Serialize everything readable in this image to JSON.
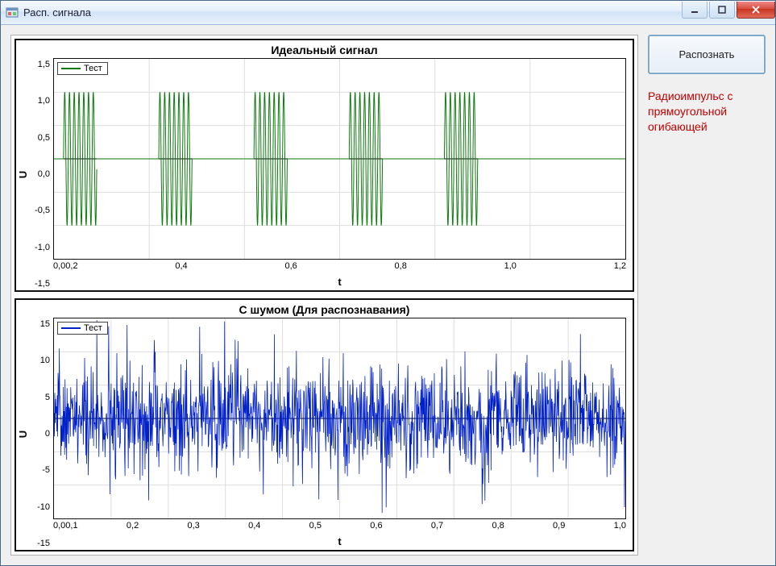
{
  "window": {
    "title": "Расп. сигнала"
  },
  "side": {
    "recognize_label": "Распознать",
    "result_text": "Радиоимпульс с прямоугольной огибающей"
  },
  "chart_data": [
    {
      "type": "line",
      "title": "Идеальный сигнал",
      "xlabel": "t",
      "ylabel": "U",
      "xlim": [
        0.0,
        1.2
      ],
      "ylim": [
        -1.5,
        1.5
      ],
      "x_ticks": [
        "0,0",
        "0,2",
        "0,4",
        "0,6",
        "0,8",
        "1,0",
        "1,2"
      ],
      "y_ticks": [
        "1,5",
        "1,0",
        "0,5",
        "0,0",
        "-0,5",
        "-1,0",
        "-1,5"
      ],
      "legend": "Тест",
      "color": "#0a7a0a",
      "description": "5 rectangular-envelope sine bursts, amplitude ±1",
      "bursts": [
        {
          "t_start": 0.02,
          "t_end": 0.09,
          "freq_hz": 100,
          "amplitude": 1.0
        },
        {
          "t_start": 0.22,
          "t_end": 0.29,
          "freq_hz": 100,
          "amplitude": 1.0
        },
        {
          "t_start": 0.42,
          "t_end": 0.49,
          "freq_hz": 100,
          "amplitude": 1.0
        },
        {
          "t_start": 0.62,
          "t_end": 0.69,
          "freq_hz": 100,
          "amplitude": 1.0
        },
        {
          "t_start": 0.82,
          "t_end": 0.89,
          "freq_hz": 100,
          "amplitude": 1.0
        }
      ]
    },
    {
      "type": "line",
      "title": "С шумом (Для распознавания)",
      "xlabel": "t",
      "ylabel": "U",
      "xlim": [
        0.0,
        1.0
      ],
      "ylim": [
        -15,
        15
      ],
      "x_ticks": [
        "0,0",
        "0,1",
        "0,2",
        "0,3",
        "0,4",
        "0,5",
        "0,6",
        "0,7",
        "0,8",
        "0,9",
        "1,0"
      ],
      "y_ticks": [
        "15",
        "10",
        "5",
        "0",
        "-5",
        "-10",
        "-15"
      ],
      "legend": "Тест",
      "color": "#0020c8",
      "description": "Same bursts embedded in wideband noise, peaks approx ±15, rms approx 5",
      "noise_peak": 15,
      "noise_typical": 5
    }
  ]
}
